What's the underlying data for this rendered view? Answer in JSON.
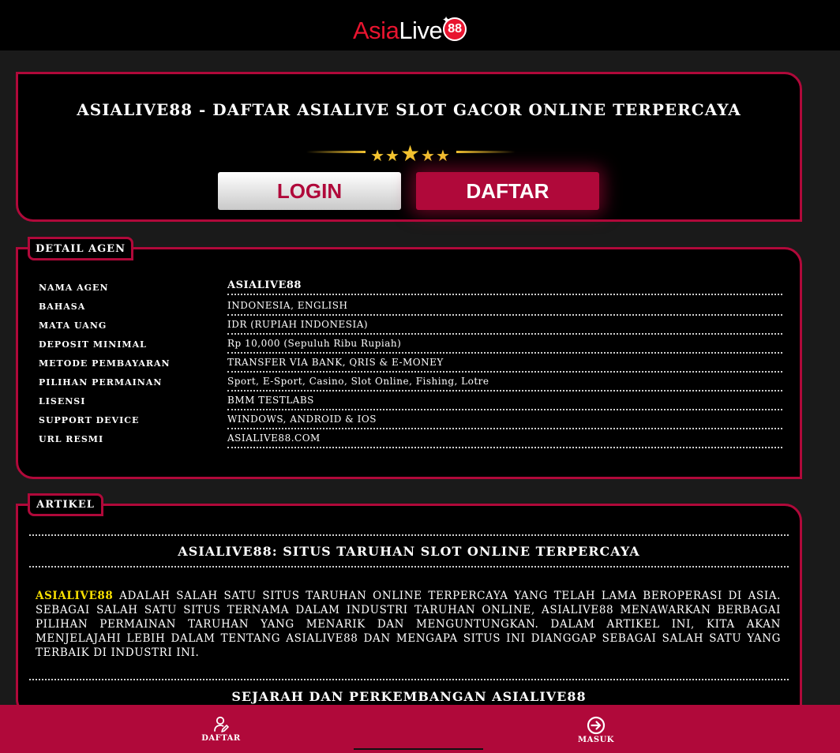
{
  "brand": {
    "logo_part1": "Asia",
    "logo_part2": "Live",
    "logo_badge": "88",
    "accent_color": "#b0093a",
    "logo_red": "#e8142f"
  },
  "hero": {
    "title": "ASIALIVE88 - DAFTAR ASIALIVE SLOT GACOR ONLINE TERPERCAYA",
    "rating_stars": 5,
    "login_label": "LOGIN",
    "daftar_label": "DAFTAR"
  },
  "detail": {
    "tab_label": "DETAIL AGEN",
    "rows": [
      {
        "label": "NAMA AGEN",
        "value": "ASIALIVE88"
      },
      {
        "label": "BAHASA",
        "value": "INDONESIA, ENGLISH"
      },
      {
        "label": "MATA UANG",
        "value": "IDR (RUPIAH INDONESIA)"
      },
      {
        "label": "DEPOSIT MINIMAL",
        "value": "Rp 10,000 (Sepuluh Ribu Rupiah)"
      },
      {
        "label": "METODE PEMBAYARAN",
        "value": "TRANSFER VIA BANK, QRIS & E-MONEY"
      },
      {
        "label": "PILIHAN PERMAINAN",
        "value": "Sport, E-Sport, Casino, Slot Online, Fishing, Lotre"
      },
      {
        "label": "LISENSI",
        "value": "BMM TESTLABS"
      },
      {
        "label": "SUPPORT DEVICE",
        "value": "WINDOWS, ANDROID & IOS"
      },
      {
        "label": "URL RESMI",
        "value": "ASIALIVE88.COM"
      }
    ]
  },
  "artikel": {
    "tab_label": "ARTIKEL",
    "heading": "ASIALIVE88: SITUS TARUHAN SLOT ONLINE TERPERCAYA",
    "intro_highlight": "ASIALIVE88",
    "intro_text": " ADALAH SALAH SATU SITUS TARUHAN ONLINE TERPERCAYA YANG TELAH LAMA BEROPERASI DI ASIA. SEBAGAI SALAH SATU SITUS TERNAMA DALAM INDUSTRI TARUHAN ONLINE, ASIALIVE88 MENAWARKAN BERBAGAI PILIHAN PERMAINAN TARUHAN YANG MENARIK DAN MENGUNTUNGKAN. DALAM ARTIKEL INI, KITA AKAN MENJELAJAHI LEBIH DALAM TENTANG ASIALIVE88 DAN MENGAPA SITUS INI DIANGGAP SEBAGAI SALAH SATU YANG TERBAIK DI INDUSTRI INI.",
    "subheading": "SEJARAH DAN PERKEMBANGAN ASIALIVE88"
  },
  "footer": {
    "daftar_label": "DAFTAR",
    "daftar_icon": "user-edit-icon",
    "masuk_label": "MASUK",
    "masuk_icon": "login-arrow-icon"
  }
}
